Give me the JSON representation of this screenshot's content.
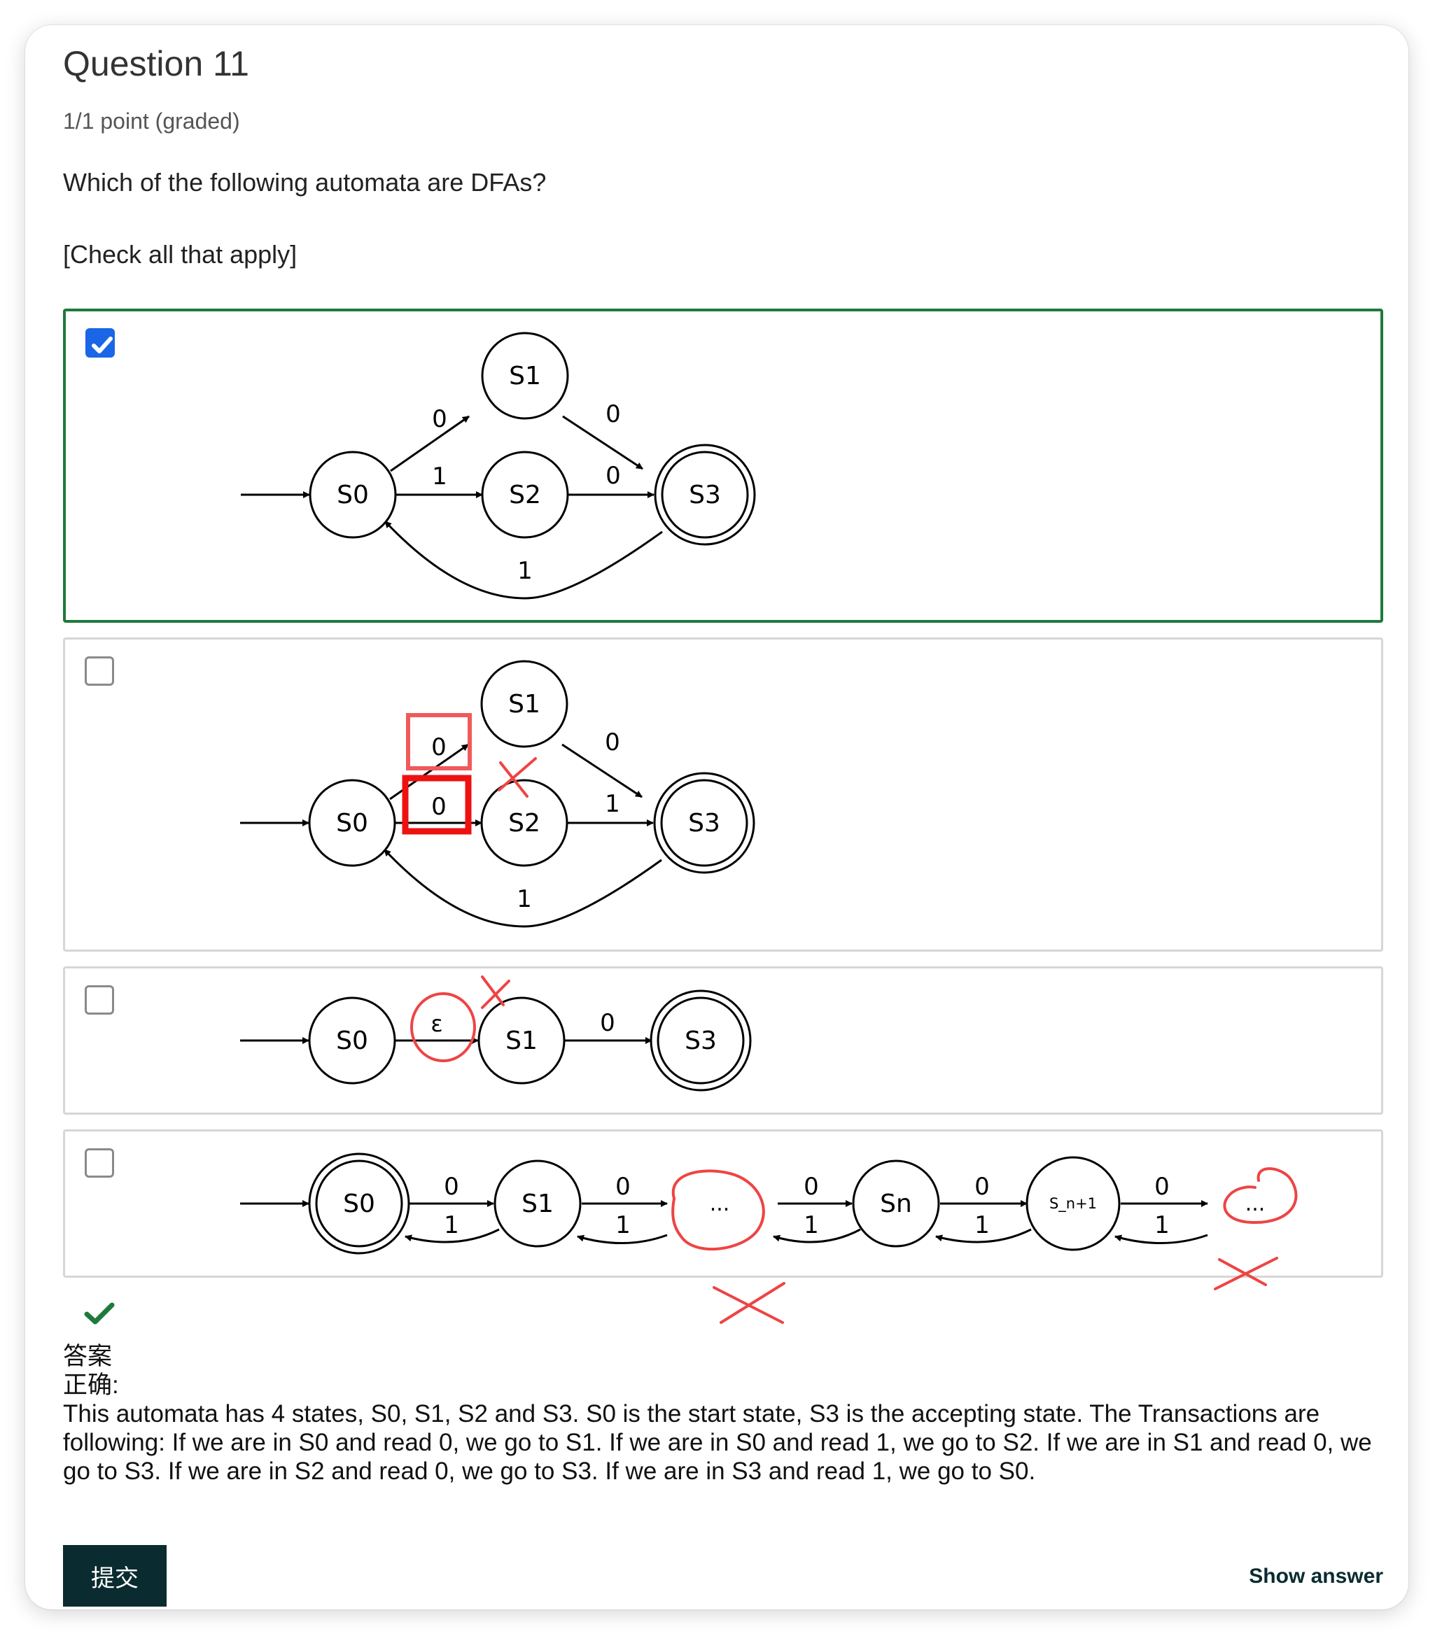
{
  "question": {
    "title": "Question 11",
    "points": "1/1 point (graded)",
    "prompt": "Which of the following automata are DFAs?",
    "hint": "[Check all that apply]"
  },
  "choices": [
    {
      "checked": true,
      "states": [
        "S0",
        "S1",
        "S2",
        "S3"
      ],
      "labels": {
        "s0_s1": "0",
        "s0_s2": "1",
        "s1_s3": "0",
        "s2_s3": "0",
        "s3_s0": "1"
      }
    },
    {
      "checked": false,
      "states": [
        "S0",
        "S1",
        "S2",
        "S3"
      ],
      "labels": {
        "s0_s1": "0",
        "s0_s2": "0",
        "s1_s3": "0",
        "s2_s3": "1",
        "s3_s0": "1"
      }
    },
    {
      "checked": false,
      "states": [
        "S0",
        "S1",
        "S3"
      ],
      "labels": {
        "s0_s1": "ε",
        "s1_s3": "0"
      }
    },
    {
      "checked": false,
      "states": [
        "S0",
        "S1",
        "...",
        "Sn",
        "S_n+1",
        "..."
      ],
      "labels": {
        "forward": "0",
        "backward": "1"
      }
    }
  ],
  "feedback": {
    "status_icon": "check-icon",
    "answer_heading": "答案",
    "correct_label": "正确:",
    "explanation": "This automata has 4 states, S0, S1, S2 and S3. S0 is the start state, S3 is the accepting state. The Transactions are following: If we are in S0 and read 0, we go to S1. If we are in S0 and read 1, we go to S2. If we are in S1 and read 0, we go to S3. If we are in S2 and read 0, we go to S3. If we are in S3 and read 1, we go to S0."
  },
  "actions": {
    "submit_label": "提交",
    "show_answer_label": "Show answer"
  },
  "colors": {
    "selected_border": "#1e7a3c",
    "checkbox_blue": "#1a66e6",
    "annotation_red": "#ee4444",
    "submit_bg": "#0a2b2f"
  }
}
